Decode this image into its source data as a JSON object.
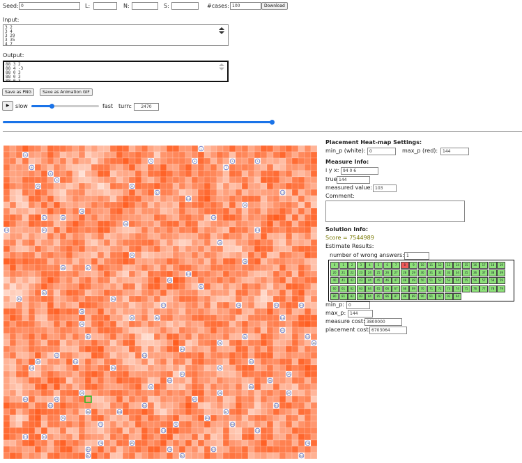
{
  "controls": {
    "seed_label": "Seed:",
    "seed_value": "0",
    "l_label": "L:",
    "l_value": "",
    "n_label": "N:",
    "n_value": "",
    "s_label": "S:",
    "s_value": "",
    "cases_label": "#cases:",
    "cases_value": "100",
    "download_label": "Download"
  },
  "input": {
    "label": "Input:",
    "text": "3 2\n3 4\n3 29\n3 35\n4 7"
  },
  "output": {
    "label": "Output:",
    "text": "88 3 2\n88 4 -3\n88 0 3\n88 0 3\n88 0 3"
  },
  "buttons": {
    "save_png": "Save as PNG",
    "save_gif": "Save as Animation GIF",
    "play": "▶"
  },
  "playback": {
    "slow_label": "slow",
    "fast_label": "fast",
    "turn_label": "turn:",
    "turn_value": "2470",
    "speed_fraction": 0.3,
    "turn_fraction": 1.0
  },
  "heatmap_settings": {
    "title": "Placement Heat-map Settings:",
    "min_label": "min_p (white):",
    "min_value": "0",
    "max_label": "max_p (red):",
    "max_value": "144"
  },
  "measure_info": {
    "title": "Measure Info:",
    "iyx_label": "i y x:",
    "iyx_value": "94 0 6",
    "true_label": "true value:",
    "true_value": "144",
    "measured_label": "measured value:",
    "measured_value": "103",
    "comment_label": "Comment:"
  },
  "solution_info": {
    "title": "Solution Info:",
    "score": "Score = 7544989",
    "estimate_label": "Estimate Results:",
    "wrong_label": "number of wrong answers:",
    "wrong_value": "1",
    "answers": [
      "0",
      "1",
      "2",
      "3",
      "4",
      "5",
      "6",
      "7",
      "8",
      "9",
      "10",
      "11",
      "12",
      "13",
      "14",
      "15",
      "16",
      "17",
      "18",
      "19",
      "20",
      "21",
      "22",
      "23",
      "24",
      "25",
      "26",
      "27",
      "28",
      "29",
      "30",
      "31",
      "32",
      "33",
      "34",
      "35",
      "36",
      "37",
      "38",
      "39",
      "40",
      "41",
      "42",
      "43",
      "44",
      "45",
      "46",
      "47",
      "48",
      "49",
      "50",
      "51",
      "52",
      "53",
      "54",
      "55",
      "56",
      "57",
      "58",
      "59",
      "60",
      "61",
      "62",
      "63",
      "64",
      "65",
      "66",
      "67",
      "68",
      "69",
      "70",
      "71",
      "72",
      "73",
      "74",
      "75",
      "76",
      "77",
      "78",
      "79",
      "80",
      "81",
      "82",
      "83",
      "84",
      "85",
      "86",
      "87",
      "88",
      "89",
      "90",
      "91",
      "92",
      "93",
      "94"
    ],
    "wrong_index": 8,
    "min_label": "min_p:",
    "min_value": "0",
    "max_label": "max_p:",
    "max_value": "144",
    "measure_cost_label": "measure cost:",
    "measure_cost_value": "3800000",
    "placement_cost_label": "placement cost:",
    "placement_cost_value": "6703064"
  },
  "colors": {
    "heat_low": "#ffffff",
    "heat_high": "#ff3c00",
    "accent": "#1a73e8",
    "answer_ok": "#8ee27a",
    "answer_bad": "#f05a5a",
    "exit_marker": "#6a78c8",
    "selected_cell": "#22bb22"
  },
  "grid": {
    "size": 50,
    "seed": 12345
  },
  "exit_cells": [
    {
      "label": "0",
      "r": 1,
      "c": 3
    },
    {
      "label": "1",
      "r": 0,
      "c": 31
    },
    {
      "label": "2",
      "r": 2,
      "c": 40
    },
    {
      "label": "3",
      "r": 2,
      "c": 23
    },
    {
      "label": "4",
      "r": 2,
      "c": 30
    },
    {
      "label": "5",
      "r": 2,
      "c": 36
    },
    {
      "label": "6",
      "r": 3,
      "c": 4
    },
    {
      "label": "7",
      "r": 3,
      "c": 35
    },
    {
      "label": "8",
      "r": 4,
      "c": 7
    },
    {
      "label": "9",
      "r": 5,
      "c": 8
    },
    {
      "label": "10",
      "r": 6,
      "c": 5
    },
    {
      "label": "11",
      "r": 6,
      "c": 20
    },
    {
      "label": "12",
      "r": 7,
      "c": 24
    },
    {
      "label": "13",
      "r": 7,
      "c": 44
    },
    {
      "label": "14",
      "r": 8,
      "c": 29
    },
    {
      "label": "15",
      "r": 9,
      "c": 38
    },
    {
      "label": "16",
      "r": 10,
      "c": 12
    },
    {
      "label": "17",
      "r": 11,
      "c": 6
    },
    {
      "label": "18",
      "r": 11,
      "c": 9
    },
    {
      "label": "19",
      "r": 11,
      "c": 33
    },
    {
      "label": "20",
      "r": 12,
      "c": 19
    },
    {
      "label": "21",
      "r": 13,
      "c": 0
    },
    {
      "label": "22",
      "r": 13,
      "c": 6
    },
    {
      "label": "23",
      "r": 13,
      "c": 40
    },
    {
      "label": "24",
      "r": 15,
      "c": 34
    },
    {
      "label": "25",
      "r": 17,
      "c": 20
    },
    {
      "label": "26",
      "r": 18,
      "c": 38
    },
    {
      "label": "27",
      "r": 19,
      "c": 13
    },
    {
      "label": "28",
      "r": 19,
      "c": 9
    },
    {
      "label": "29",
      "r": 20,
      "c": 29
    },
    {
      "label": "30",
      "r": 21,
      "c": 26
    },
    {
      "label": "31",
      "r": 22,
      "c": 31
    },
    {
      "label": "32",
      "r": 23,
      "c": 6
    },
    {
      "label": "33",
      "r": 24,
      "c": 2
    },
    {
      "label": "34",
      "r": 24,
      "c": 17
    },
    {
      "label": "35",
      "r": 25,
      "c": 43
    },
    {
      "label": "36",
      "r": 26,
      "c": 12
    },
    {
      "label": "37",
      "r": 25,
      "c": 25
    },
    {
      "label": "38",
      "r": 25,
      "c": 37
    },
    {
      "label": "39",
      "r": 27,
      "c": 20
    },
    {
      "label": "40",
      "r": 27,
      "c": 24
    },
    {
      "label": "41",
      "r": 27,
      "c": 44
    },
    {
      "label": "42",
      "r": 30,
      "c": 38
    },
    {
      "label": "43",
      "r": 30,
      "c": 48
    },
    {
      "label": "44",
      "r": 31,
      "c": 49
    },
    {
      "label": "45",
      "r": 30,
      "c": 13
    },
    {
      "label": "46",
      "r": 32,
      "c": 28
    },
    {
      "label": "47",
      "r": 33,
      "c": 8
    },
    {
      "label": "48",
      "r": 33,
      "c": 22
    },
    {
      "label": "49",
      "r": 34,
      "c": 5
    },
    {
      "label": "50",
      "r": 34,
      "c": 39
    },
    {
      "label": "51",
      "r": 34,
      "c": 11
    },
    {
      "label": "52",
      "r": 35,
      "c": 34
    },
    {
      "label": "53",
      "r": 35,
      "c": 4
    },
    {
      "label": "54",
      "r": 35,
      "c": 17
    },
    {
      "label": "55",
      "r": 36,
      "c": 28
    },
    {
      "label": "56",
      "r": 37,
      "c": 42
    },
    {
      "label": "57",
      "r": 38,
      "c": 23
    },
    {
      "label": "58",
      "r": 39,
      "c": 34
    },
    {
      "label": "59",
      "r": 39,
      "c": 12
    },
    {
      "label": "60",
      "r": 40,
      "c": 3
    },
    {
      "label": "61",
      "r": 40,
      "c": 8
    },
    {
      "label": "62",
      "r": 40,
      "c": 30
    },
    {
      "label": "63",
      "r": 41,
      "c": 43
    },
    {
      "label": "64",
      "r": 41,
      "c": 22
    },
    {
      "label": "65",
      "r": 41,
      "c": 7
    },
    {
      "label": "66",
      "r": 42,
      "c": 18
    },
    {
      "label": "67",
      "r": 42,
      "c": 35
    },
    {
      "label": "68",
      "r": 42,
      "c": 13
    },
    {
      "label": "69",
      "r": 43,
      "c": 32
    },
    {
      "label": "70",
      "r": 43,
      "c": 9
    },
    {
      "label": "71",
      "r": 44,
      "c": 27
    },
    {
      "label": "72",
      "r": 44,
      "c": 15
    },
    {
      "label": "73",
      "r": 45,
      "c": 25
    },
    {
      "label": "74",
      "r": 45,
      "c": 40
    },
    {
      "label": "75",
      "r": 46,
      "c": 6
    },
    {
      "label": "76",
      "r": 47,
      "c": 48
    },
    {
      "label": "77",
      "r": 46,
      "c": 3
    },
    {
      "label": "78",
      "r": 47,
      "c": 15
    },
    {
      "label": "79",
      "r": 48,
      "c": 26
    },
    {
      "label": "80",
      "r": 48,
      "c": 13
    },
    {
      "label": "81",
      "r": 49,
      "c": 13
    },
    {
      "label": "82",
      "r": 49,
      "c": 28
    },
    {
      "label": "83",
      "r": 48,
      "c": 33
    },
    {
      "label": "84",
      "r": 49,
      "c": 47
    },
    {
      "label": "85",
      "r": 47,
      "c": 20
    },
    {
      "label": "86",
      "r": 44,
      "c": 36
    },
    {
      "label": "87",
      "r": 39,
      "c": 45
    },
    {
      "label": "88",
      "r": 38,
      "c": 39
    },
    {
      "label": "89",
      "r": 37,
      "c": 26
    },
    {
      "label": "90",
      "r": 36,
      "c": 45
    },
    {
      "label": "91",
      "r": 31,
      "c": 34
    },
    {
      "label": "92",
      "r": 29,
      "c": 44
    },
    {
      "label": "93",
      "r": 25,
      "c": 47
    },
    {
      "label": "94",
      "r": 28,
      "c": 12
    }
  ],
  "selected_cell": {
    "r": 40,
    "c": 13
  }
}
